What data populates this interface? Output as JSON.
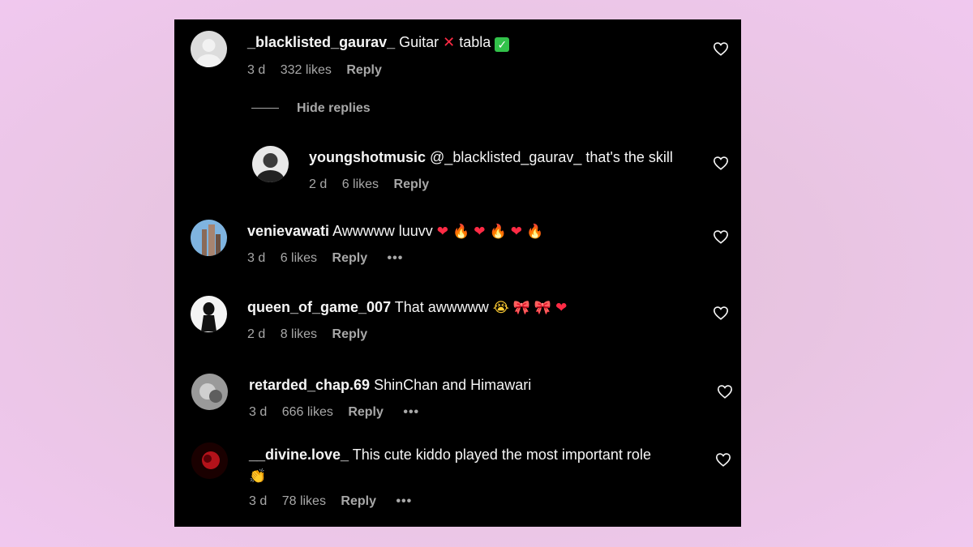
{
  "comments": [
    {
      "username": "_blacklisted_gaurav_",
      "text_parts": [
        "Guitar",
        "tabla"
      ],
      "time": "3 d",
      "likes": "332 likes",
      "reply": "Reply"
    },
    {
      "hide_replies": "Hide replies"
    },
    {
      "username": "youngshotmusic",
      "text": "@_blacklisted_gaurav_ that's the skill",
      "time": "2 d",
      "likes": "6 likes",
      "reply": "Reply"
    },
    {
      "username": "venievawati",
      "text": "Awwwww luuvv",
      "time": "3 d",
      "likes": "6 likes",
      "reply": "Reply",
      "more": "•••"
    },
    {
      "username": "queen_of_game_007",
      "text": "That awwwww",
      "time": "2 d",
      "likes": "8 likes",
      "reply": "Reply"
    },
    {
      "username": "retarded_chap.69",
      "text": "ShinChan and Himawari",
      "time": "3 d",
      "likes": "666 likes",
      "reply": "Reply",
      "more": "•••"
    },
    {
      "username": "__divine.love_",
      "text": "This cute kiddo played the most important role",
      "time": "3 d",
      "likes": "78 likes",
      "reply": "Reply",
      "more": "•••"
    }
  ],
  "icons": {
    "like": "heart-outline-icon",
    "cross": "cross-mark-icon",
    "check": "check-mark-icon"
  },
  "colors": {
    "background": "#000000",
    "text": "#f5f5f5",
    "meta": "#a8a8a8",
    "heart_emoji": "#ff2b45",
    "fire_emoji": "#ff8a1c",
    "check": "#32c24a"
  }
}
